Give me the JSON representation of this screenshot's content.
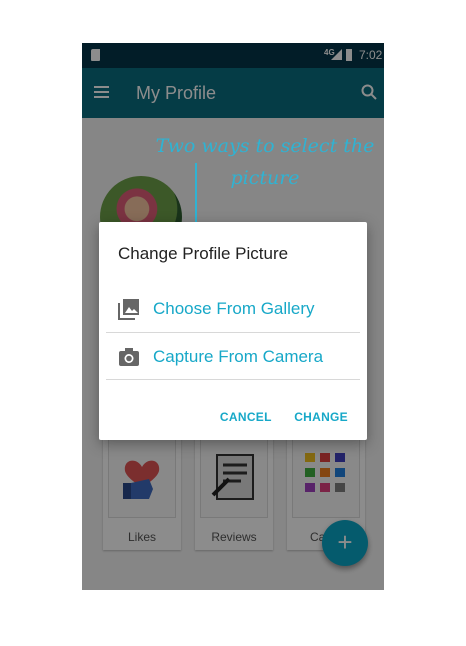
{
  "status_bar": {
    "network": "4G",
    "time": "7:02"
  },
  "app_bar": {
    "title": "My Profile"
  },
  "annotation": {
    "line1": "Two ways to select the",
    "line2": "picture"
  },
  "dialog": {
    "title": "Change Profile Picture",
    "options": [
      {
        "label": "Choose From Gallery",
        "icon": "gallery-icon"
      },
      {
        "label": "Capture From Camera",
        "icon": "camera-icon"
      }
    ],
    "cancel_label": "CANCEL",
    "change_label": "CHANGE"
  },
  "cards": [
    {
      "label": "Likes",
      "icon": "likes-icon"
    },
    {
      "label": "Reviews",
      "icon": "reviews-icon"
    },
    {
      "label": "Categ",
      "icon": "categories-icon"
    }
  ],
  "fab": {
    "label": "+"
  },
  "colors": {
    "accent": "#17a8c8",
    "app_bar": "#0a6e80",
    "annotation": "#2fb3d3"
  }
}
